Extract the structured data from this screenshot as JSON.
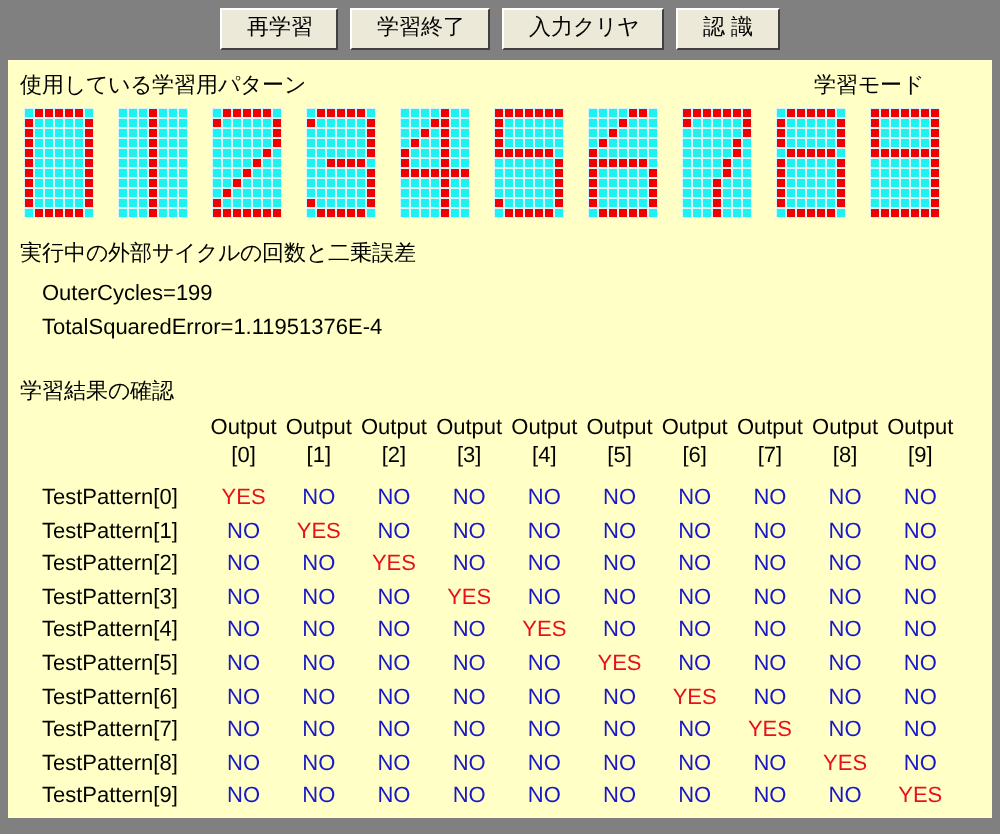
{
  "toolbar": {
    "buttons": [
      "再学習",
      "学習終了",
      "入力クリヤ",
      "認 識"
    ]
  },
  "patterns_section": {
    "title": "使用している学習用パターン",
    "mode": "学習モード",
    "patterns": [
      {
        "rows": [
          [
            false,
            true,
            true,
            true,
            true,
            true,
            false
          ],
          [
            true,
            false,
            false,
            false,
            false,
            false,
            true
          ],
          [
            true,
            false,
            false,
            false,
            false,
            false,
            true
          ],
          [
            true,
            false,
            false,
            false,
            false,
            false,
            true
          ],
          [
            true,
            false,
            false,
            false,
            false,
            false,
            true
          ],
          [
            true,
            false,
            false,
            false,
            false,
            false,
            true
          ],
          [
            true,
            false,
            false,
            false,
            false,
            false,
            true
          ],
          [
            true,
            false,
            false,
            false,
            false,
            false,
            true
          ],
          [
            true,
            false,
            false,
            false,
            false,
            false,
            true
          ],
          [
            true,
            false,
            false,
            false,
            false,
            false,
            true
          ],
          [
            false,
            true,
            true,
            true,
            true,
            true,
            false
          ]
        ]
      },
      {
        "rows": [
          [
            false,
            false,
            false,
            true,
            false,
            false,
            false
          ],
          [
            false,
            false,
            false,
            true,
            false,
            false,
            false
          ],
          [
            false,
            false,
            false,
            true,
            false,
            false,
            false
          ],
          [
            false,
            false,
            false,
            true,
            false,
            false,
            false
          ],
          [
            false,
            false,
            false,
            true,
            false,
            false,
            false
          ],
          [
            false,
            false,
            false,
            true,
            false,
            false,
            false
          ],
          [
            false,
            false,
            false,
            true,
            false,
            false,
            false
          ],
          [
            false,
            false,
            false,
            true,
            false,
            false,
            false
          ],
          [
            false,
            false,
            false,
            true,
            false,
            false,
            false
          ],
          [
            false,
            false,
            false,
            true,
            false,
            false,
            false
          ],
          [
            false,
            false,
            false,
            true,
            false,
            false,
            false
          ]
        ]
      },
      {
        "rows": [
          [
            false,
            true,
            true,
            true,
            true,
            true,
            false
          ],
          [
            true,
            false,
            false,
            false,
            false,
            false,
            true
          ],
          [
            false,
            false,
            false,
            false,
            false,
            false,
            true
          ],
          [
            false,
            false,
            false,
            false,
            false,
            false,
            true
          ],
          [
            false,
            false,
            false,
            false,
            false,
            true,
            false
          ],
          [
            false,
            false,
            false,
            false,
            true,
            false,
            false
          ],
          [
            false,
            false,
            false,
            true,
            false,
            false,
            false
          ],
          [
            false,
            false,
            true,
            false,
            false,
            false,
            false
          ],
          [
            false,
            true,
            false,
            false,
            false,
            false,
            false
          ],
          [
            true,
            false,
            false,
            false,
            false,
            false,
            false
          ],
          [
            true,
            true,
            true,
            true,
            true,
            true,
            true
          ]
        ]
      },
      {
        "rows": [
          [
            false,
            true,
            true,
            true,
            true,
            true,
            false
          ],
          [
            true,
            false,
            false,
            false,
            false,
            false,
            true
          ],
          [
            false,
            false,
            false,
            false,
            false,
            false,
            true
          ],
          [
            false,
            false,
            false,
            false,
            false,
            false,
            true
          ],
          [
            false,
            false,
            false,
            false,
            false,
            false,
            true
          ],
          [
            false,
            false,
            true,
            true,
            true,
            true,
            false
          ],
          [
            false,
            false,
            false,
            false,
            false,
            false,
            true
          ],
          [
            false,
            false,
            false,
            false,
            false,
            false,
            true
          ],
          [
            false,
            false,
            false,
            false,
            false,
            false,
            true
          ],
          [
            true,
            false,
            false,
            false,
            false,
            false,
            true
          ],
          [
            false,
            true,
            true,
            true,
            true,
            true,
            false
          ]
        ]
      },
      {
        "rows": [
          [
            false,
            false,
            false,
            false,
            true,
            false,
            false
          ],
          [
            false,
            false,
            false,
            true,
            true,
            false,
            false
          ],
          [
            false,
            false,
            true,
            false,
            true,
            false,
            false
          ],
          [
            false,
            true,
            false,
            false,
            true,
            false,
            false
          ],
          [
            true,
            false,
            false,
            false,
            true,
            false,
            false
          ],
          [
            true,
            false,
            false,
            false,
            true,
            false,
            false
          ],
          [
            true,
            true,
            true,
            true,
            true,
            true,
            true
          ],
          [
            false,
            false,
            false,
            false,
            true,
            false,
            false
          ],
          [
            false,
            false,
            false,
            false,
            true,
            false,
            false
          ],
          [
            false,
            false,
            false,
            false,
            true,
            false,
            false
          ],
          [
            false,
            false,
            false,
            false,
            true,
            false,
            false
          ]
        ]
      },
      {
        "rows": [
          [
            true,
            true,
            true,
            true,
            true,
            true,
            true
          ],
          [
            true,
            false,
            false,
            false,
            false,
            false,
            false
          ],
          [
            true,
            false,
            false,
            false,
            false,
            false,
            false
          ],
          [
            true,
            false,
            false,
            false,
            false,
            false,
            false
          ],
          [
            true,
            true,
            true,
            true,
            true,
            true,
            false
          ],
          [
            false,
            false,
            false,
            false,
            false,
            false,
            true
          ],
          [
            false,
            false,
            false,
            false,
            false,
            false,
            true
          ],
          [
            false,
            false,
            false,
            false,
            false,
            false,
            true
          ],
          [
            false,
            false,
            false,
            false,
            false,
            false,
            true
          ],
          [
            true,
            false,
            false,
            false,
            false,
            false,
            true
          ],
          [
            false,
            true,
            true,
            true,
            true,
            true,
            false
          ]
        ]
      },
      {
        "rows": [
          [
            false,
            false,
            false,
            false,
            true,
            true,
            false
          ],
          [
            false,
            false,
            false,
            true,
            false,
            false,
            false
          ],
          [
            false,
            false,
            true,
            false,
            false,
            false,
            false
          ],
          [
            false,
            true,
            false,
            false,
            false,
            false,
            false
          ],
          [
            true,
            false,
            false,
            false,
            false,
            false,
            false
          ],
          [
            true,
            true,
            true,
            true,
            true,
            true,
            false
          ],
          [
            true,
            false,
            false,
            false,
            false,
            false,
            true
          ],
          [
            true,
            false,
            false,
            false,
            false,
            false,
            true
          ],
          [
            true,
            false,
            false,
            false,
            false,
            false,
            true
          ],
          [
            true,
            false,
            false,
            false,
            false,
            false,
            true
          ],
          [
            false,
            true,
            true,
            true,
            true,
            true,
            false
          ]
        ]
      },
      {
        "rows": [
          [
            true,
            true,
            true,
            true,
            true,
            true,
            true
          ],
          [
            true,
            false,
            false,
            false,
            false,
            false,
            true
          ],
          [
            false,
            false,
            false,
            false,
            false,
            false,
            true
          ],
          [
            false,
            false,
            false,
            false,
            false,
            true,
            false
          ],
          [
            false,
            false,
            false,
            false,
            false,
            true,
            false
          ],
          [
            false,
            false,
            false,
            false,
            true,
            false,
            false
          ],
          [
            false,
            false,
            false,
            false,
            true,
            false,
            false
          ],
          [
            false,
            false,
            false,
            true,
            false,
            false,
            false
          ],
          [
            false,
            false,
            false,
            true,
            false,
            false,
            false
          ],
          [
            false,
            false,
            false,
            true,
            false,
            false,
            false
          ],
          [
            false,
            false,
            false,
            true,
            false,
            false,
            false
          ]
        ]
      },
      {
        "rows": [
          [
            false,
            true,
            true,
            true,
            true,
            true,
            false
          ],
          [
            true,
            false,
            false,
            false,
            false,
            false,
            true
          ],
          [
            true,
            false,
            false,
            false,
            false,
            false,
            true
          ],
          [
            true,
            false,
            false,
            false,
            false,
            false,
            true
          ],
          [
            false,
            true,
            true,
            true,
            true,
            true,
            false
          ],
          [
            true,
            false,
            false,
            false,
            false,
            false,
            true
          ],
          [
            true,
            false,
            false,
            false,
            false,
            false,
            true
          ],
          [
            true,
            false,
            false,
            false,
            false,
            false,
            true
          ],
          [
            true,
            false,
            false,
            false,
            false,
            false,
            true
          ],
          [
            true,
            false,
            false,
            false,
            false,
            false,
            true
          ],
          [
            false,
            true,
            true,
            true,
            true,
            true,
            false
          ]
        ]
      },
      {
        "rows": [
          [
            true,
            true,
            true,
            true,
            true,
            true,
            true
          ],
          [
            true,
            false,
            false,
            false,
            false,
            false,
            true
          ],
          [
            true,
            false,
            false,
            false,
            false,
            false,
            true
          ],
          [
            true,
            false,
            false,
            false,
            false,
            false,
            true
          ],
          [
            true,
            true,
            true,
            true,
            true,
            true,
            true
          ],
          [
            false,
            false,
            false,
            false,
            false,
            false,
            true
          ],
          [
            false,
            false,
            false,
            false,
            false,
            false,
            true
          ],
          [
            false,
            false,
            false,
            false,
            false,
            false,
            true
          ],
          [
            false,
            false,
            false,
            false,
            false,
            false,
            true
          ],
          [
            false,
            false,
            false,
            false,
            false,
            false,
            true
          ],
          [
            true,
            true,
            true,
            true,
            true,
            true,
            true
          ]
        ]
      }
    ]
  },
  "progress_section": {
    "title": "実行中の外部サイクルの回数と二乗誤差",
    "lines": [
      "OuterCycles=199",
      "TotalSquaredError=1.11951376E-4"
    ]
  },
  "results_section": {
    "title": "学習結果の確認",
    "columns": [
      {
        "line1": "Output",
        "line2": "[0]"
      },
      {
        "line1": "Output",
        "line2": "[1]"
      },
      {
        "line1": "Output",
        "line2": "[2]"
      },
      {
        "line1": "Output",
        "line2": "[3]"
      },
      {
        "line1": "Output",
        "line2": "[4]"
      },
      {
        "line1": "Output",
        "line2": "[5]"
      },
      {
        "line1": "Output",
        "line2": "[6]"
      },
      {
        "line1": "Output",
        "line2": "[7]"
      },
      {
        "line1": "Output",
        "line2": "[8]"
      },
      {
        "line1": "Output",
        "line2": "[9]"
      }
    ],
    "rows": [
      {
        "label": "TestPattern[0]",
        "cells": [
          {
            "text": "YES",
            "kind": "yes"
          },
          {
            "text": "NO",
            "kind": "no"
          },
          {
            "text": "NO",
            "kind": "no"
          },
          {
            "text": "NO",
            "kind": "no"
          },
          {
            "text": "NO",
            "kind": "no"
          },
          {
            "text": "NO",
            "kind": "no"
          },
          {
            "text": "NO",
            "kind": "no"
          },
          {
            "text": "NO",
            "kind": "no"
          },
          {
            "text": "NO",
            "kind": "no"
          },
          {
            "text": "NO",
            "kind": "no"
          }
        ]
      },
      {
        "label": "TestPattern[1]",
        "cells": [
          {
            "text": "NO",
            "kind": "no"
          },
          {
            "text": "YES",
            "kind": "yes"
          },
          {
            "text": "NO",
            "kind": "no"
          },
          {
            "text": "NO",
            "kind": "no"
          },
          {
            "text": "NO",
            "kind": "no"
          },
          {
            "text": "NO",
            "kind": "no"
          },
          {
            "text": "NO",
            "kind": "no"
          },
          {
            "text": "NO",
            "kind": "no"
          },
          {
            "text": "NO",
            "kind": "no"
          },
          {
            "text": "NO",
            "kind": "no"
          }
        ]
      },
      {
        "label": "TestPattern[2]",
        "cells": [
          {
            "text": "NO",
            "kind": "no"
          },
          {
            "text": "NO",
            "kind": "no"
          },
          {
            "text": "YES",
            "kind": "yes"
          },
          {
            "text": "NO",
            "kind": "no"
          },
          {
            "text": "NO",
            "kind": "no"
          },
          {
            "text": "NO",
            "kind": "no"
          },
          {
            "text": "NO",
            "kind": "no"
          },
          {
            "text": "NO",
            "kind": "no"
          },
          {
            "text": "NO",
            "kind": "no"
          },
          {
            "text": "NO",
            "kind": "no"
          }
        ]
      },
      {
        "label": "TestPattern[3]",
        "cells": [
          {
            "text": "NO",
            "kind": "no"
          },
          {
            "text": "NO",
            "kind": "no"
          },
          {
            "text": "NO",
            "kind": "no"
          },
          {
            "text": "YES",
            "kind": "yes"
          },
          {
            "text": "NO",
            "kind": "no"
          },
          {
            "text": "NO",
            "kind": "no"
          },
          {
            "text": "NO",
            "kind": "no"
          },
          {
            "text": "NO",
            "kind": "no"
          },
          {
            "text": "NO",
            "kind": "no"
          },
          {
            "text": "NO",
            "kind": "no"
          }
        ]
      },
      {
        "label": "TestPattern[4]",
        "cells": [
          {
            "text": "NO",
            "kind": "no"
          },
          {
            "text": "NO",
            "kind": "no"
          },
          {
            "text": "NO",
            "kind": "no"
          },
          {
            "text": "NO",
            "kind": "no"
          },
          {
            "text": "YES",
            "kind": "yes"
          },
          {
            "text": "NO",
            "kind": "no"
          },
          {
            "text": "NO",
            "kind": "no"
          },
          {
            "text": "NO",
            "kind": "no"
          },
          {
            "text": "NO",
            "kind": "no"
          },
          {
            "text": "NO",
            "kind": "no"
          }
        ]
      },
      {
        "label": "TestPattern[5]",
        "cells": [
          {
            "text": "NO",
            "kind": "no"
          },
          {
            "text": "NO",
            "kind": "no"
          },
          {
            "text": "NO",
            "kind": "no"
          },
          {
            "text": "NO",
            "kind": "no"
          },
          {
            "text": "NO",
            "kind": "no"
          },
          {
            "text": "YES",
            "kind": "yes"
          },
          {
            "text": "NO",
            "kind": "no"
          },
          {
            "text": "NO",
            "kind": "no"
          },
          {
            "text": "NO",
            "kind": "no"
          },
          {
            "text": "NO",
            "kind": "no"
          }
        ]
      },
      {
        "label": "TestPattern[6]",
        "cells": [
          {
            "text": "NO",
            "kind": "no"
          },
          {
            "text": "NO",
            "kind": "no"
          },
          {
            "text": "NO",
            "kind": "no"
          },
          {
            "text": "NO",
            "kind": "no"
          },
          {
            "text": "NO",
            "kind": "no"
          },
          {
            "text": "NO",
            "kind": "no"
          },
          {
            "text": "YES",
            "kind": "yes"
          },
          {
            "text": "NO",
            "kind": "no"
          },
          {
            "text": "NO",
            "kind": "no"
          },
          {
            "text": "NO",
            "kind": "no"
          }
        ]
      },
      {
        "label": "TestPattern[7]",
        "cells": [
          {
            "text": "NO",
            "kind": "no"
          },
          {
            "text": "NO",
            "kind": "no"
          },
          {
            "text": "NO",
            "kind": "no"
          },
          {
            "text": "NO",
            "kind": "no"
          },
          {
            "text": "NO",
            "kind": "no"
          },
          {
            "text": "NO",
            "kind": "no"
          },
          {
            "text": "NO",
            "kind": "no"
          },
          {
            "text": "YES",
            "kind": "yes"
          },
          {
            "text": "NO",
            "kind": "no"
          },
          {
            "text": "NO",
            "kind": "no"
          }
        ]
      },
      {
        "label": "TestPattern[8]",
        "cells": [
          {
            "text": "NO",
            "kind": "no"
          },
          {
            "text": "NO",
            "kind": "no"
          },
          {
            "text": "NO",
            "kind": "no"
          },
          {
            "text": "NO",
            "kind": "no"
          },
          {
            "text": "NO",
            "kind": "no"
          },
          {
            "text": "NO",
            "kind": "no"
          },
          {
            "text": "NO",
            "kind": "no"
          },
          {
            "text": "NO",
            "kind": "no"
          },
          {
            "text": "YES",
            "kind": "yes"
          },
          {
            "text": "NO",
            "kind": "no"
          }
        ]
      },
      {
        "label": "TestPattern[9]",
        "cells": [
          {
            "text": "NO",
            "kind": "no"
          },
          {
            "text": "NO",
            "kind": "no"
          },
          {
            "text": "NO",
            "kind": "no"
          },
          {
            "text": "NO",
            "kind": "no"
          },
          {
            "text": "NO",
            "kind": "no"
          },
          {
            "text": "NO",
            "kind": "no"
          },
          {
            "text": "NO",
            "kind": "no"
          },
          {
            "text": "NO",
            "kind": "no"
          },
          {
            "text": "NO",
            "kind": "no"
          },
          {
            "text": "YES",
            "kind": "yes"
          }
        ]
      }
    ]
  }
}
